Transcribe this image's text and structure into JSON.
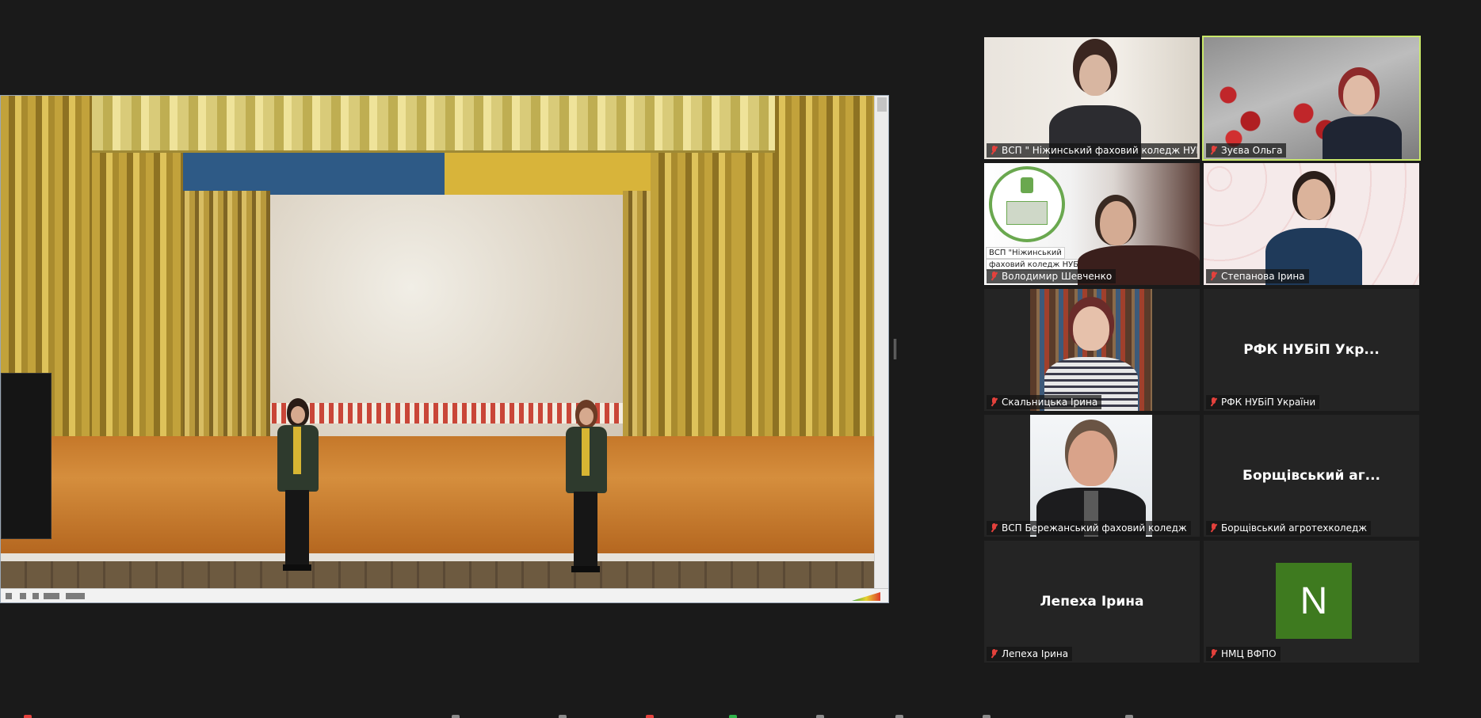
{
  "tiles": [
    {
      "name": "ВСП \" Ніжинський фаховий коледж НУБі...",
      "muted": true
    },
    {
      "name": "Зуєва Ольга",
      "muted": true,
      "active": true
    },
    {
      "name": "Володимир Шевченко",
      "muted": true
    },
    {
      "name": "Степанова Ірина",
      "muted": true
    },
    {
      "name": "Скальницька Ірина",
      "muted": true
    },
    {
      "name": "РФК НУБіП України",
      "display": "РФК НУБіП Укр...",
      "muted": true
    },
    {
      "name": "ВСП Бережанський фаховий коледж",
      "muted": true
    },
    {
      "name": "Борщівський агротехколедж",
      "display": "Борщівський аг...",
      "muted": true
    },
    {
      "name": "Лепеха Ірина",
      "display": "Лепеха Ірина",
      "muted": true
    },
    {
      "name": "НМЦ ВФПО",
      "avatar_letter": "N",
      "avatar_color": "#3e7a1f",
      "muted": true
    }
  ],
  "logo_text": {
    "line1": "ВСП \"Ніжинський",
    "line2": "фаховий коледж НУБіП"
  },
  "colors": {
    "background": "#1a1a1a",
    "active_speaker": "#c9e86a",
    "muted_mic": "#e3413c"
  }
}
